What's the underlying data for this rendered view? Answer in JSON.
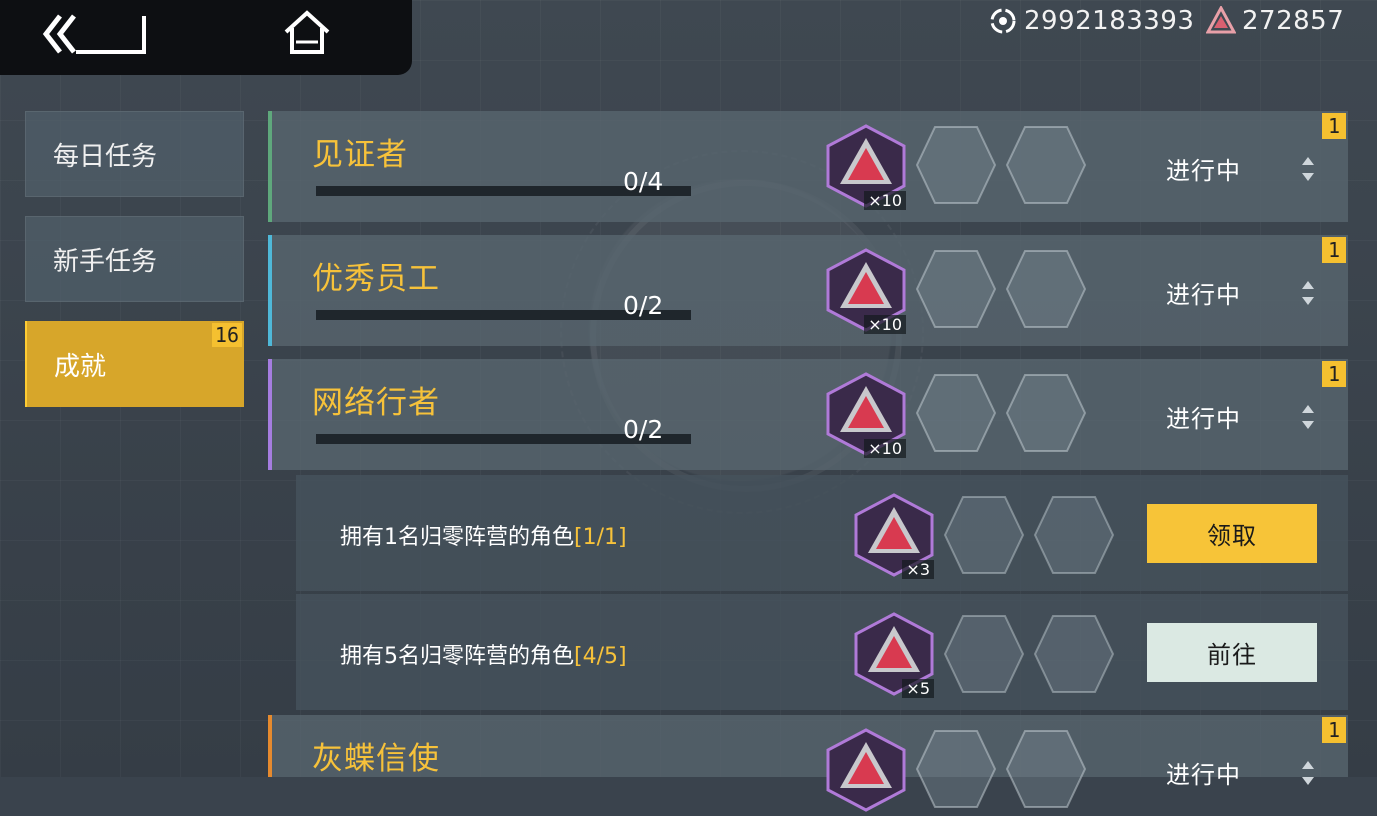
{
  "nav": {
    "back_label": "back",
    "home_label": "home"
  },
  "currency": {
    "credits": "2992183393",
    "gems": "272857"
  },
  "sidebar": {
    "items": [
      {
        "label": "每日任务",
        "active": false
      },
      {
        "label": "新手任务",
        "active": false
      },
      {
        "label": "成就",
        "active": true,
        "badge": "16"
      }
    ]
  },
  "achievements": [
    {
      "title": "见证者",
      "progress": "0/4",
      "status": "进行中",
      "badge": "1",
      "stripe": "#5fa87c",
      "reward_count": "×10"
    },
    {
      "title": "优秀员工",
      "progress": "0/2",
      "status": "进行中",
      "badge": "1",
      "stripe": "#4fb8d8",
      "reward_count": "×10"
    },
    {
      "title": "网络行者",
      "progress": "0/2",
      "status": "进行中",
      "badge": "1",
      "stripe": "#a57de0",
      "reward_count": "×10"
    },
    {
      "title": "灰蝶信使",
      "progress": "",
      "status": "进行中",
      "badge": "1",
      "stripe": "#e68a2e",
      "reward_count": ""
    }
  ],
  "subtasks": [
    {
      "text": "拥有1名归零阵营的角色",
      "count": "[1/1]",
      "reward_count": "×3",
      "button": "领取",
      "button_type": "claim"
    },
    {
      "text": "拥有5名归零阵营的角色",
      "count": "[4/5]",
      "reward_count": "×5",
      "button": "前往",
      "button_type": "goto"
    }
  ]
}
